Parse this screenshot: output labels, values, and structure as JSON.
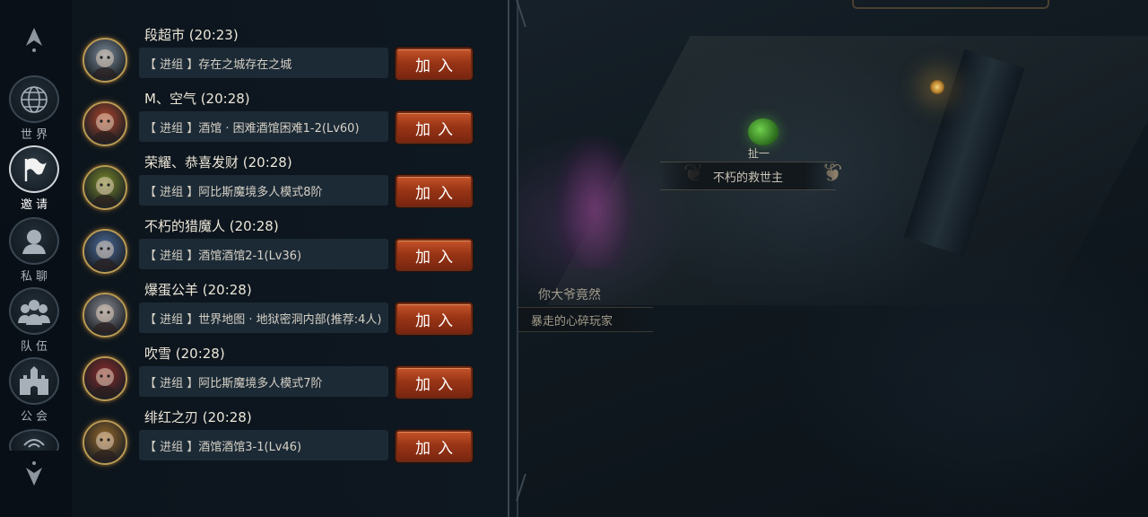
{
  "scene": {
    "npc_label": "扯一",
    "npc_title": "不朽的救世主",
    "player_name": "你大爷竟然",
    "player_title": "暴走的心碎玩家"
  },
  "sidebar": {
    "items": [
      {
        "label": "世界",
        "icon": "globe-icon"
      },
      {
        "label": "邀请",
        "icon": "flag-icon",
        "active": true
      },
      {
        "label": "私聊",
        "icon": "person-icon"
      },
      {
        "label": "队伍",
        "icon": "team-icon"
      },
      {
        "label": "公会",
        "icon": "castle-icon"
      }
    ]
  },
  "invites": [
    {
      "name": "段超市 (20:23)",
      "message": "【 进组 】存在之城存在之城",
      "button": "加入",
      "avatar": "hooded-girl-avatar",
      "avatar_color": "#7a8a9a"
    },
    {
      "name": "M、空气 (20:28)",
      "message": "【 进组 】酒馆 · 困难酒馆困难1-2(Lv60)",
      "button": "加入",
      "avatar": "dwarf-avatar",
      "avatar_color": "#b0452a"
    },
    {
      "name": "荣耀、恭喜发财 (20:28)",
      "message": "【 进组 】阿比斯魔境多人模式8阶",
      "button": "加入",
      "avatar": "golden-mask-avatar",
      "avatar_color": "#7a8a2a"
    },
    {
      "name": "不朽的猎魔人 (20:28)",
      "message": "【 进组 】酒馆酒馆2-1(Lv36)",
      "button": "加入",
      "avatar": "blue-beast-avatar",
      "avatar_color": "#4a6a9a"
    },
    {
      "name": "爆蛋公羊 (20:28)",
      "message": "【 进组 】世界地图 · 地狱密洞内部(推荐:4人)",
      "button": "加入",
      "avatar": "silver-hair-avatar",
      "avatar_color": "#8a8a92"
    },
    {
      "name": "吹雪 (20:28)",
      "message": "【 进组 】阿比斯魔境多人模式7阶",
      "button": "加入",
      "avatar": "red-demon-avatar",
      "avatar_color": "#8a2a2a"
    },
    {
      "name": "绯红之刃 (20:28)",
      "message": "【 进组 】酒馆酒馆3-1(Lv46)",
      "button": "加入",
      "avatar": "crimson-blade-avatar",
      "avatar_color": "#9a6a2a"
    }
  ]
}
